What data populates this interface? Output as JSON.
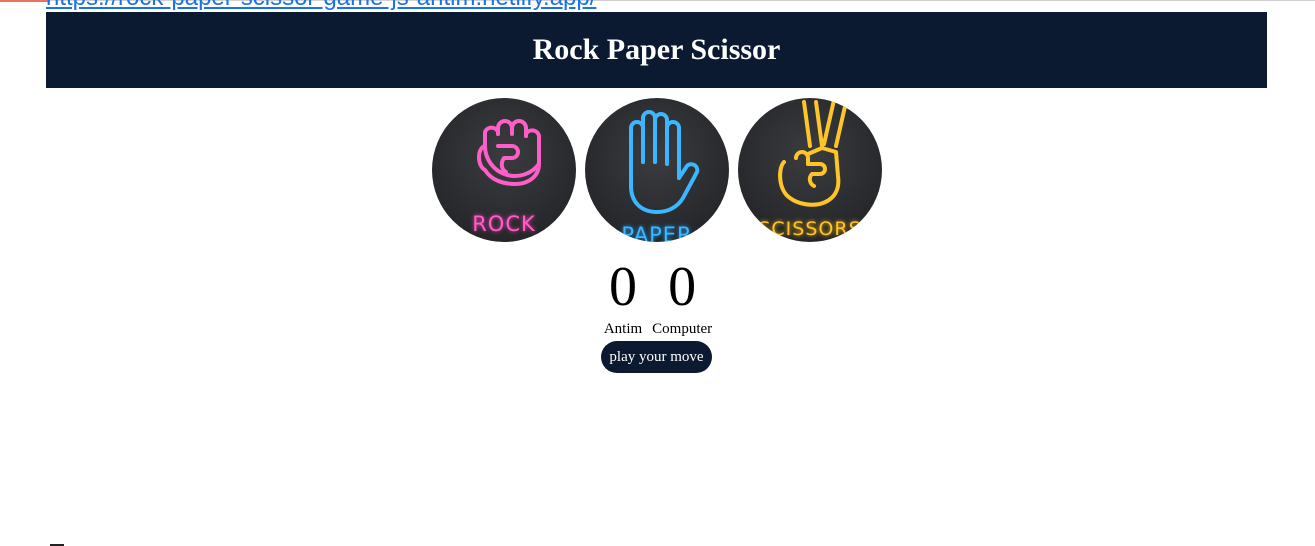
{
  "page": {
    "link_text": "https://rock-paper-scissor-game-js-antim.netlify.app/",
    "title": "Rock Paper Scissor"
  },
  "choices": [
    {
      "id": "rock",
      "label": "ROCK",
      "color": "#ff5ec8",
      "icon": "fist-icon"
    },
    {
      "id": "paper",
      "label": "PAPER",
      "color": "#3cb6ff",
      "icon": "open-hand-icon"
    },
    {
      "id": "scissors",
      "label": "SCISSORS",
      "color": "#ffc526",
      "icon": "victory-hand-icon"
    }
  ],
  "scoreboard": {
    "user": {
      "score": "0",
      "name": "Antim"
    },
    "computer": {
      "score": "0",
      "name": "Computer"
    }
  },
  "message": {
    "text": "play your move"
  },
  "colors": {
    "banner": "#0b1a30",
    "link": "#1a73e8"
  }
}
